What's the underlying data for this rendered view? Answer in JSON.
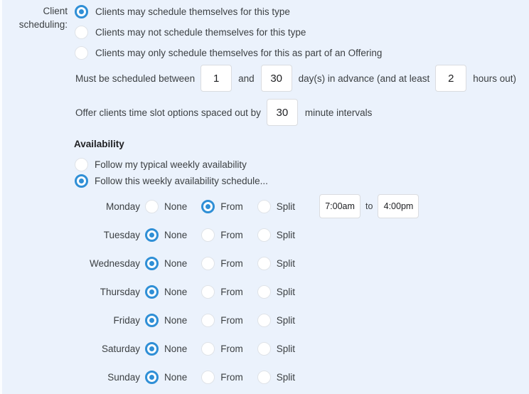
{
  "panel": {
    "background_color": "#ebf2fc",
    "accent_color": "#2f8fd6"
  },
  "field_label": {
    "line1": "Client",
    "line2": "scheduling:"
  },
  "scheduling_options": [
    {
      "label": "Clients may schedule themselves for this type",
      "selected": true
    },
    {
      "label": "Clients may not schedule themselves for this type",
      "selected": false
    },
    {
      "label": "Clients may only schedule themselves for this as part of an Offering",
      "selected": false
    }
  ],
  "advance_rule": {
    "prefix": "Must be scheduled between",
    "min_days": "1",
    "joiner": "and",
    "max_days": "30",
    "middle": "day(s) in advance (and at least",
    "hours_out": "2",
    "suffix": "hours out)"
  },
  "interval_rule": {
    "prefix": "Offer clients time slot options spaced out by",
    "minutes": "30",
    "suffix": "minute intervals"
  },
  "availability": {
    "heading": "Availability",
    "modes": [
      {
        "label": "Follow my typical weekly availability",
        "selected": false
      },
      {
        "label": "Follow this weekly availability schedule...",
        "selected": true
      }
    ],
    "option_labels": {
      "none": "None",
      "from": "From",
      "split": "Split"
    },
    "to_label": "to",
    "days": [
      {
        "name": "Monday",
        "mode": "from",
        "start_time": "7:00am",
        "end_time": "4:00pm"
      },
      {
        "name": "Tuesday",
        "mode": "none",
        "start_time": "",
        "end_time": ""
      },
      {
        "name": "Wednesday",
        "mode": "none",
        "start_time": "",
        "end_time": ""
      },
      {
        "name": "Thursday",
        "mode": "none",
        "start_time": "",
        "end_time": ""
      },
      {
        "name": "Friday",
        "mode": "none",
        "start_time": "",
        "end_time": ""
      },
      {
        "name": "Saturday",
        "mode": "none",
        "start_time": "",
        "end_time": ""
      },
      {
        "name": "Sunday",
        "mode": "none",
        "start_time": "",
        "end_time": ""
      }
    ]
  }
}
